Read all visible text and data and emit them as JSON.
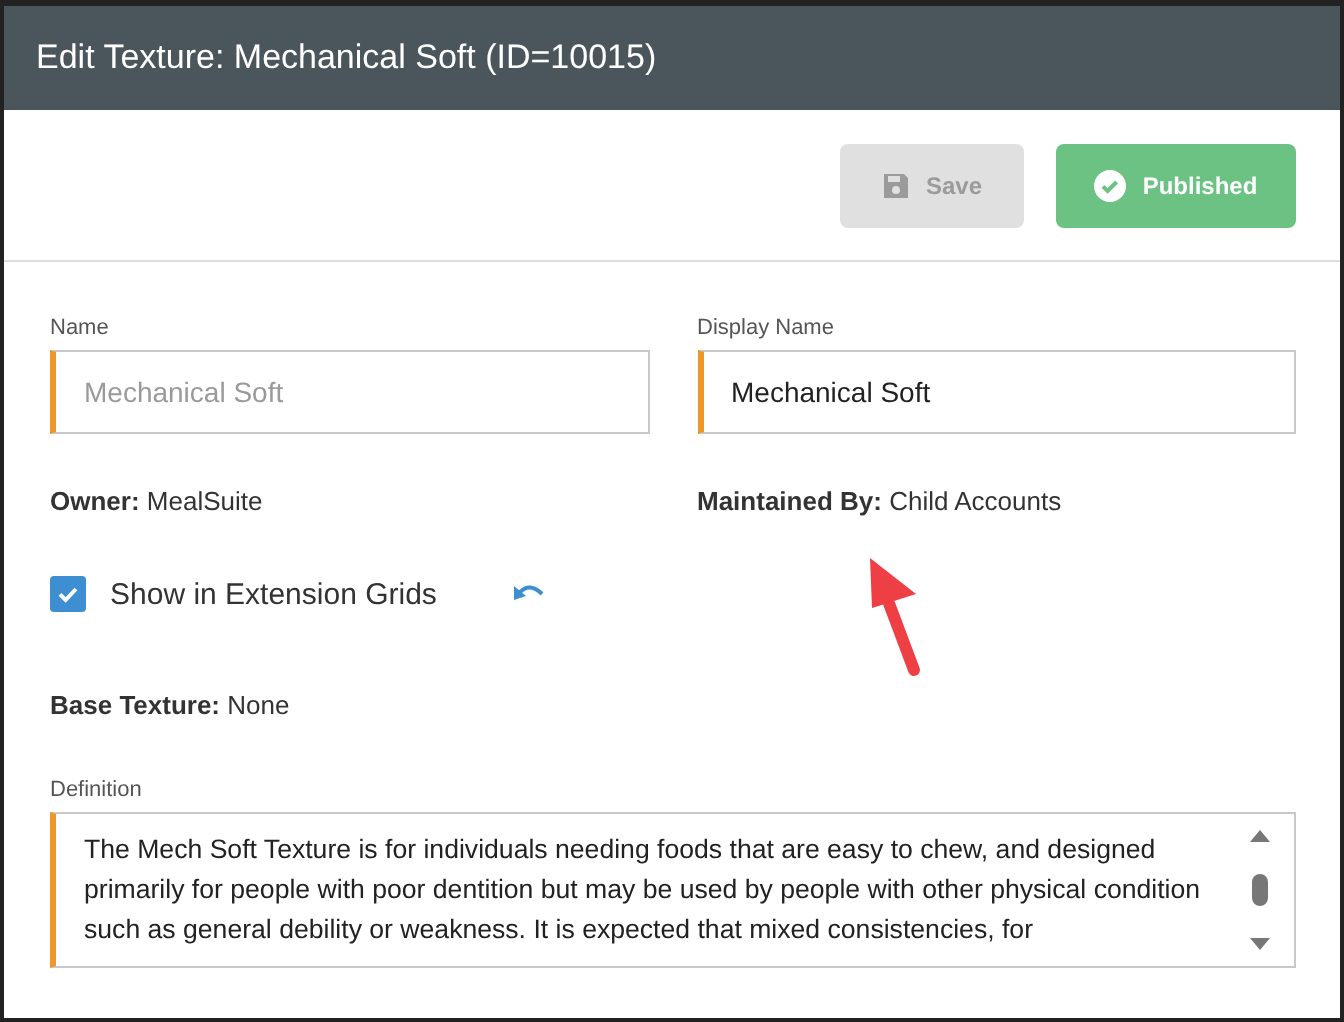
{
  "window": {
    "title": "Edit Texture: Mechanical Soft (ID=10015)"
  },
  "toolbar": {
    "buttons": [
      {
        "label": "Save",
        "kind": "save",
        "disabled": true
      },
      {
        "label": "Published",
        "kind": "published",
        "disabled": false
      }
    ]
  },
  "fields": [
    {
      "label": "Name",
      "value": "Mechanical Soft",
      "disabled": true
    },
    {
      "label": "Display Name",
      "value": "Mechanical Soft",
      "disabled": false
    }
  ],
  "info": [
    {
      "label": "Owner:",
      "value": "MealSuite"
    },
    {
      "label": "Maintained By:",
      "value": "Child Accounts"
    }
  ],
  "show_in_extension_grids": {
    "label": "Show in Extension Grids",
    "checked": true
  },
  "base_texture": {
    "label": "Base Texture:",
    "value": "None"
  },
  "definition": {
    "label": "Definition",
    "value": "The Mech Soft Texture is for individuals needing foods that are easy to chew, and designed primarily for people with poor dentition but may be used by people with other physical condition such as general debility or weakness. It is expected that mixed consistencies, for"
  }
}
